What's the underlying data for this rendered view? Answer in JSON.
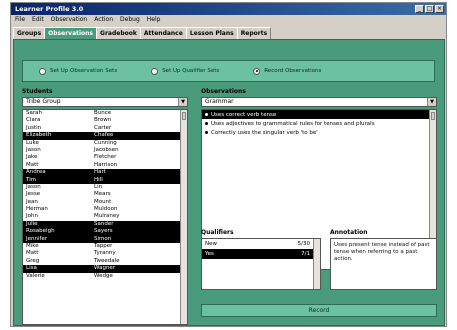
{
  "window": {
    "title": "Learner Profile 3.0",
    "controls": [
      "_",
      "□",
      "×"
    ]
  },
  "menu": [
    "File",
    "Edit",
    "Observation",
    "Action",
    "Debug",
    "Help"
  ],
  "tabs": [
    {
      "label": "Groups",
      "active": false
    },
    {
      "label": "Observations",
      "active": true
    },
    {
      "label": "Gradebook",
      "active": false
    },
    {
      "label": "Attendance",
      "active": false
    },
    {
      "label": "Lesson Plans",
      "active": false
    },
    {
      "label": "Reports",
      "active": false
    }
  ],
  "setup_options": [
    {
      "label": "Set Up Observation Sets",
      "selected": false
    },
    {
      "label": "Set Up Qualifier Sets",
      "selected": false
    },
    {
      "label": "Record Observations",
      "selected": true
    }
  ],
  "students": {
    "label": "Students",
    "group_select": "Tribe Group",
    "rows": [
      {
        "first": "Sarah",
        "last": "Bunce",
        "selected": false
      },
      {
        "first": "Clara",
        "last": "Brown",
        "selected": false
      },
      {
        "first": "Justin",
        "last": "Carter",
        "selected": false
      },
      {
        "first": "Elizabeth",
        "last": "Chafee",
        "selected": true
      },
      {
        "first": "Luke",
        "last": "Cunning",
        "selected": false
      },
      {
        "first": "Jason",
        "last": "Jacobsen",
        "selected": false
      },
      {
        "first": "Jake",
        "last": "Fletcher",
        "selected": false
      },
      {
        "first": "Matt",
        "last": "Harrison",
        "selected": false
      },
      {
        "first": "Andrea",
        "last": "Hart",
        "selected": true
      },
      {
        "first": "Tim",
        "last": "Hill",
        "selected": true
      },
      {
        "first": "Jason",
        "last": "Lin",
        "selected": false
      },
      {
        "first": "Jesse",
        "last": "Mears",
        "selected": false
      },
      {
        "first": "Jean",
        "last": "Mount",
        "selected": false
      },
      {
        "first": "Herman",
        "last": "Muldoon",
        "selected": false
      },
      {
        "first": "John",
        "last": "Mulraney",
        "selected": false
      },
      {
        "first": "Julie",
        "last": "Sander",
        "selected": true
      },
      {
        "first": "Rosabeigh",
        "last": "Sayers",
        "selected": true
      },
      {
        "first": "Jennifer",
        "last": "Simon",
        "selected": true
      },
      {
        "first": "Mike",
        "last": "Tapper",
        "selected": false
      },
      {
        "first": "Matt",
        "last": "Tyranny",
        "selected": false
      },
      {
        "first": "Greg",
        "last": "Tweedale",
        "selected": false
      },
      {
        "first": "Lisa",
        "last": "Wagner",
        "selected": true
      },
      {
        "first": "Valerie",
        "last": "Wedge",
        "selected": false
      }
    ]
  },
  "observations": {
    "label": "Observations",
    "category_select": "Grammar",
    "items": [
      {
        "text": "Uses correct verb tense",
        "selected": true
      },
      {
        "text": "Uses adjectives to grammatical rules for tenses and plurals",
        "selected": false
      },
      {
        "text": "Correctly uses the singular verb 'to be'",
        "selected": false
      }
    ]
  },
  "qualifiers": {
    "label": "Qualifiers",
    "rows": [
      {
        "name": "New",
        "value": "5/30",
        "selected": false
      },
      {
        "name": "Yes",
        "value": "7/1",
        "selected": true
      }
    ]
  },
  "annotation": {
    "label": "Annotation",
    "text": "Uses present tense instead of past tense when referring to a past action."
  },
  "record_label": "Record",
  "colors": {
    "panel": "#4a9b7c",
    "panel_light": "#6cc2a0",
    "title_start": "#0a246a",
    "title_end": "#3a6ea5",
    "chrome": "#d4d0c8"
  }
}
